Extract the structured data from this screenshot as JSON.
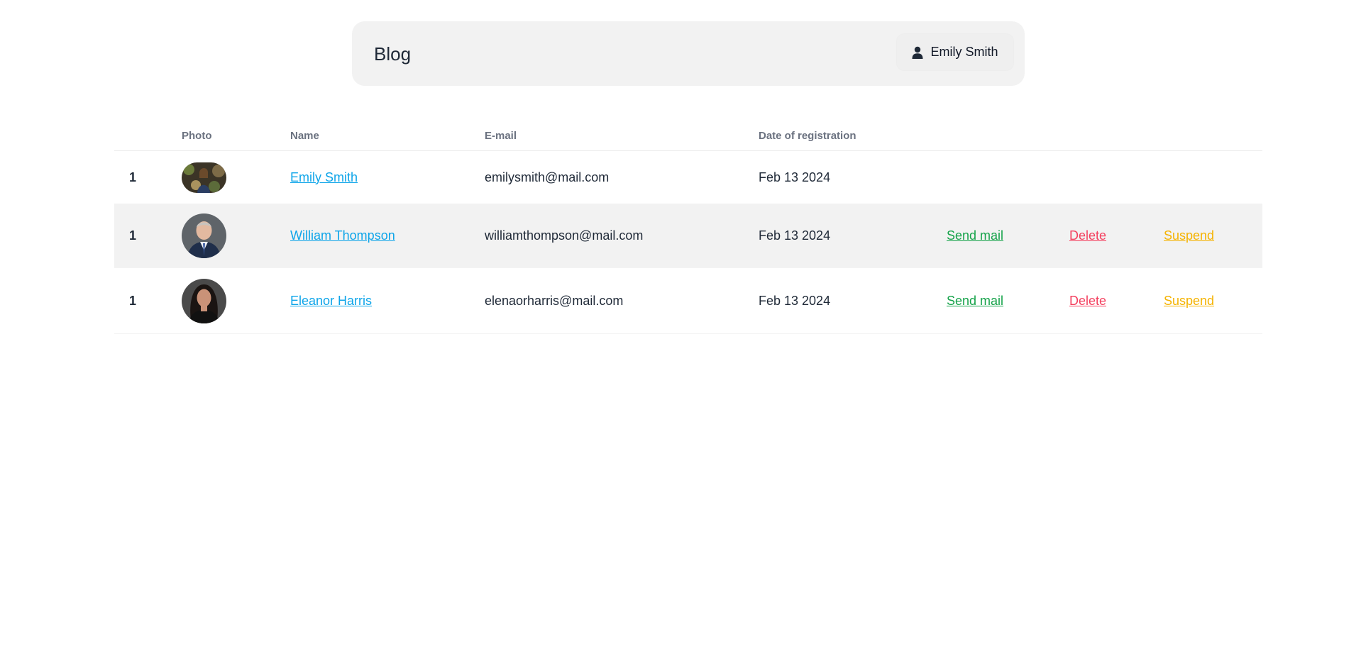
{
  "header": {
    "brand": "Blog",
    "user_name": "Emily Smith",
    "user_icon": "user-icon"
  },
  "table": {
    "columns": [
      "",
      "Photo",
      "Name",
      "E-mail",
      "Date of registration",
      "",
      "",
      ""
    ],
    "rows": [
      {
        "num": "1",
        "name": "Emily Smith",
        "email": "emilysmith@mail.com",
        "date": "Feb 13 2024",
        "send": "",
        "delete": "",
        "suspend": ""
      },
      {
        "num": "1",
        "name": "William Thompson",
        "email": "williamthompson@mail.com",
        "date": "Feb 13 2024",
        "send": "Send mail",
        "delete": "Delete",
        "suspend": "Suspend"
      },
      {
        "num": "1",
        "name": "Eleanor Harris",
        "email": "elenaorharris@mail.com",
        "date": "Feb 13 2024",
        "send": "Send mail",
        "delete": "Delete",
        "suspend": "Suspend"
      }
    ]
  },
  "colors": {
    "link": "#0ea5e9",
    "send": "#16a34a",
    "delete": "#f43f5e",
    "suspend": "#f5b300",
    "row_highlight": "#f2f2f2"
  }
}
